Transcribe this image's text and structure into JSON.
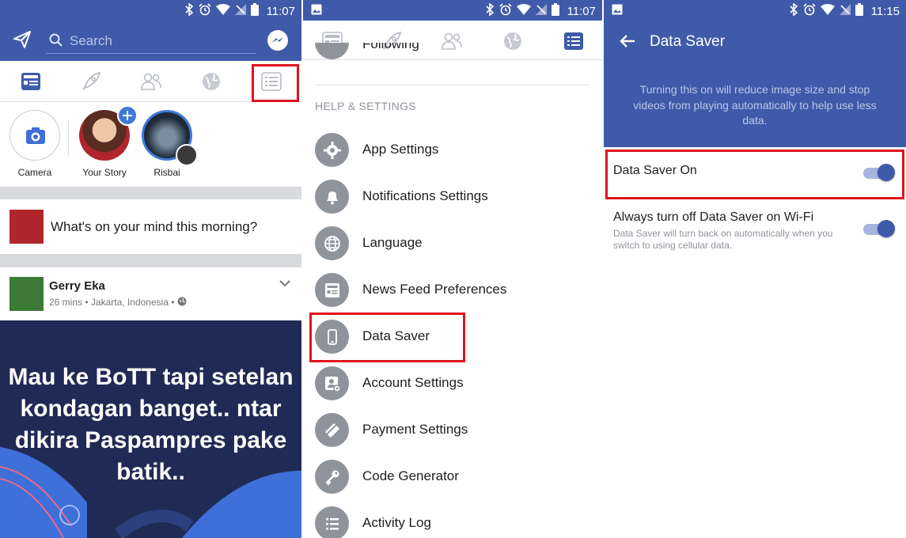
{
  "panel1": {
    "status_time": "11:07",
    "search": {
      "placeholder": "Search"
    },
    "stories": [
      {
        "label": "Camera"
      },
      {
        "label": "Your Story"
      },
      {
        "label": "Risbai"
      }
    ],
    "composer": {
      "prompt": "What's on your mind this morning?"
    },
    "post": {
      "author": "Gerry Eka",
      "time": "26 mins",
      "location": "Jakarta, Indonesia",
      "meta_separator": "•",
      "banner_text": "Mau ke BoTT tapi setelan kondagan banget.. ntar dikira Paspampres pake batik.."
    }
  },
  "panel2": {
    "status_time": "11:07",
    "partial_item": "Following",
    "section_header": "HELP & SETTINGS",
    "menu": [
      {
        "label": "App Settings",
        "icon": "gear-icon"
      },
      {
        "label": "Notifications Settings",
        "icon": "bell-icon"
      },
      {
        "label": "Language",
        "icon": "globe-icon"
      },
      {
        "label": "News Feed Preferences",
        "icon": "newsfeed-icon"
      },
      {
        "label": "Data Saver",
        "icon": "phone-icon"
      },
      {
        "label": "Account Settings",
        "icon": "account-settings-icon"
      },
      {
        "label": "Payment Settings",
        "icon": "payment-icon"
      },
      {
        "label": "Code Generator",
        "icon": "key-icon"
      },
      {
        "label": "Activity Log",
        "icon": "list-icon"
      }
    ]
  },
  "panel3": {
    "status_time": "11:15",
    "title": "Data Saver",
    "description": "Turning this on will reduce image size and stop videos from playing automatically to help use less data.",
    "options": [
      {
        "title": "Data Saver On",
        "subtitle": "",
        "enabled": true
      },
      {
        "title": "Always turn off Data Saver on Wi-Fi",
        "subtitle": "Data Saver will turn back on automatically when you switch to using cellular data.",
        "enabled": true
      }
    ]
  },
  "colors": {
    "facebook_blue": "#3f5aa8",
    "highlight_red": "#e0141e",
    "icon_gray": "#8f939a",
    "banner_bg": "#1f2a55"
  }
}
